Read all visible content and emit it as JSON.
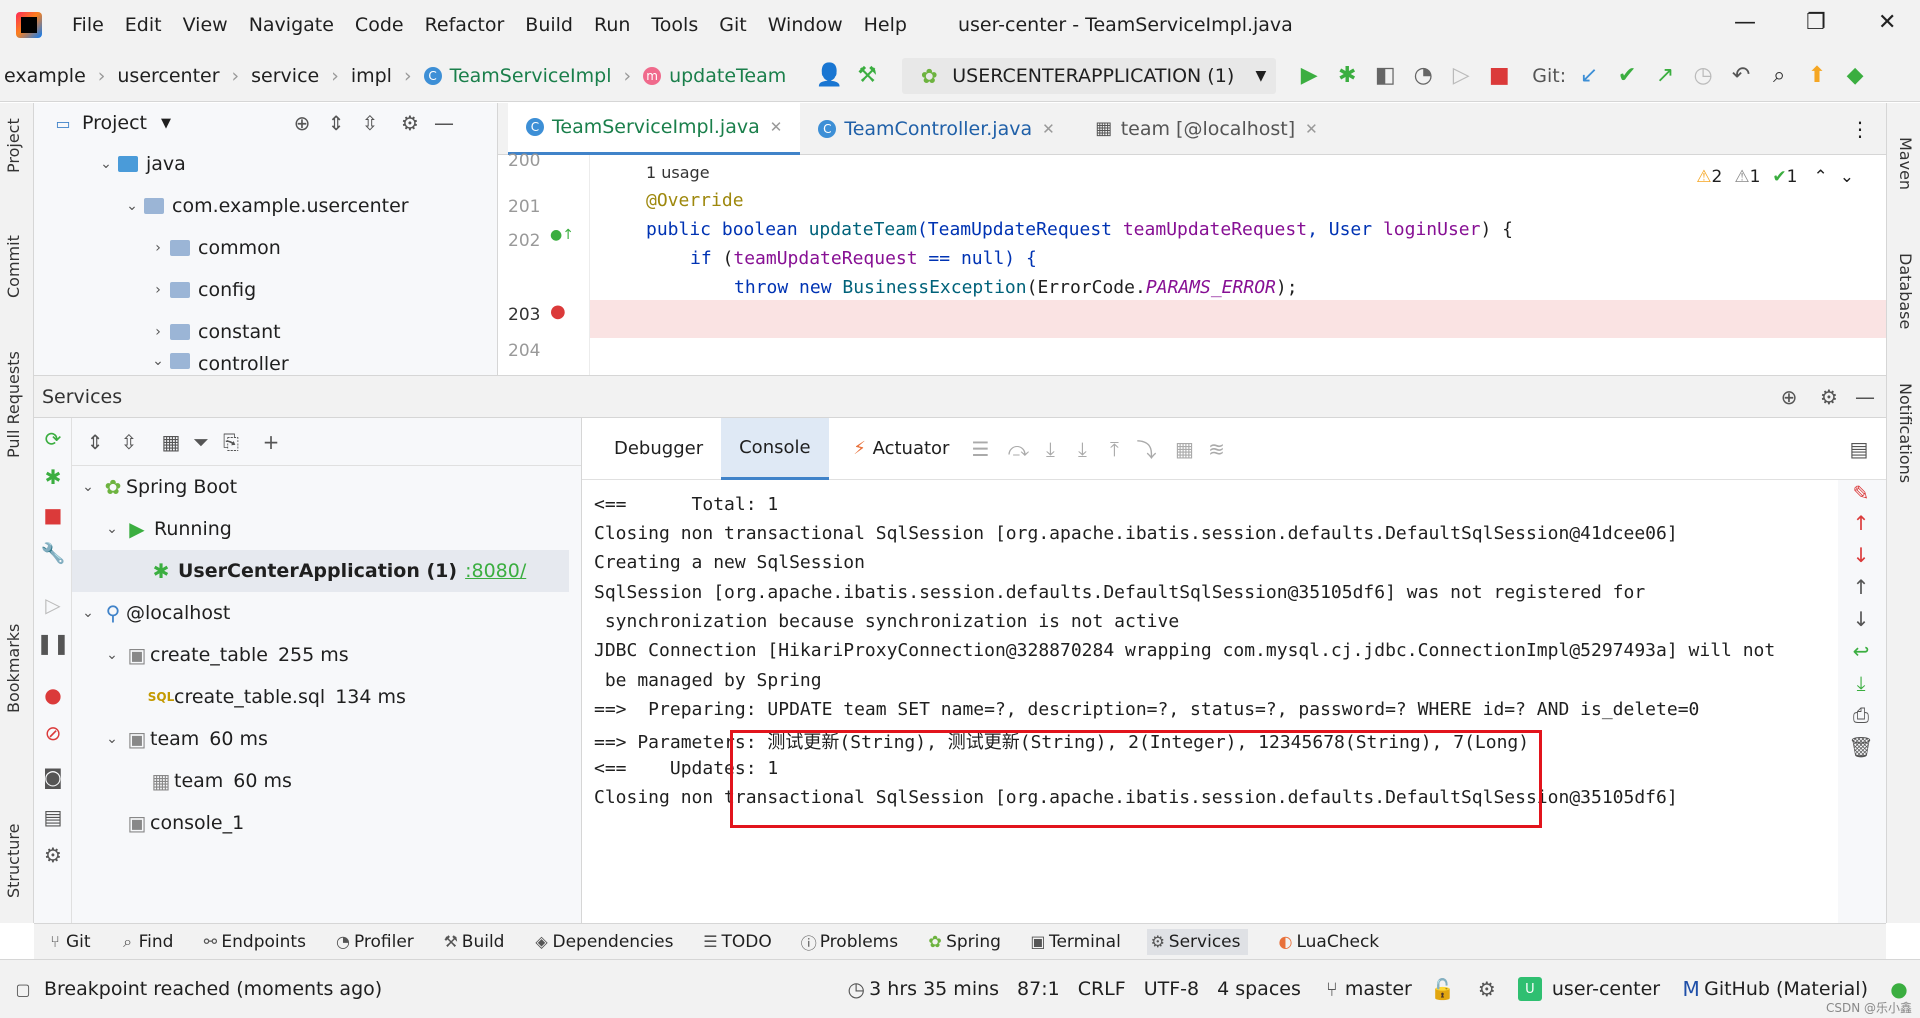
{
  "menubar": {
    "items": [
      "File",
      "Edit",
      "View",
      "Navigate",
      "Code",
      "Refactor",
      "Build",
      "Run",
      "Tools",
      "Git",
      "Window",
      "Help"
    ],
    "window_title": "user-center - TeamServiceImpl.java"
  },
  "navbar": {
    "crumbs": [
      "example",
      "usercenter",
      "service",
      "impl",
      "TeamServiceImpl",
      "updateTeam"
    ],
    "run_config": "USERCENTERAPPLICATION (1)",
    "git_label": "Git:"
  },
  "left_strip": [
    "Project",
    "Commit",
    "Pull Requests",
    "Bookmarks",
    "Structure"
  ],
  "right_strip": [
    "Maven",
    "Database",
    "Notifications"
  ],
  "project": {
    "title": "Project",
    "tree": [
      {
        "label": "java",
        "indent": 1
      },
      {
        "label": "com.example.usercenter",
        "indent": 2
      },
      {
        "label": "common",
        "indent": 3
      },
      {
        "label": "config",
        "indent": 3
      },
      {
        "label": "constant",
        "indent": 3
      },
      {
        "label": "controller",
        "indent": 3
      }
    ]
  },
  "editor": {
    "tabs": [
      "TeamServiceImpl.java",
      "TeamController.java",
      "team [@localhost]"
    ],
    "inspections": {
      "warn": "2",
      "weak": "1",
      "ok": "1"
    },
    "line_numbers": [
      "200",
      "201",
      "202",
      "203",
      "204"
    ],
    "usage": "1 usage",
    "code": {
      "l201": "@Override",
      "l202_kw": "public boolean ",
      "l202_fn": "updateTeam",
      "l202_rest": "(TeamUpdateRequest ",
      "l202_p1": "teamUpdateRequest",
      "l202_mid": ", User ",
      "l202_p2": "loginUser",
      "l202_end": ") {",
      "l203_kw": "if ",
      "l203_open": "(",
      "l203_p": "teamUpdateRequest",
      "l203_rest": " == null) {",
      "l204_kw": "throw new ",
      "l204_cls": "BusinessException",
      "l204_open": "(ErrorCode.",
      "l204_const": "PARAMS_ERROR",
      "l204_end": ");"
    }
  },
  "services": {
    "title": "Services",
    "tree": [
      {
        "label": "Spring Boot",
        "indent": 0
      },
      {
        "label": "Running",
        "indent": 1
      },
      {
        "label": "UserCenterApplication (1)",
        "extra": ":8080/",
        "indent": 2
      },
      {
        "label": "@localhost",
        "indent": 0
      },
      {
        "label": "create_table",
        "extra": "255 ms",
        "indent": 1
      },
      {
        "label": "create_table.sql",
        "extra": "134 ms",
        "indent": 2
      },
      {
        "label": "team",
        "extra": "60 ms",
        "indent": 1
      },
      {
        "label": "team",
        "extra": "60 ms",
        "indent": 2
      },
      {
        "label": "console_1",
        "indent": 1
      }
    ],
    "console_tabs": [
      "Debugger",
      "Console",
      "Actuator"
    ],
    "console_lines": [
      "<==      Total: 1",
      "Closing non transactional SqlSession [org.apache.ibatis.session.defaults.DefaultSqlSession@41dcee06]",
      "Creating a new SqlSession",
      "SqlSession [org.apache.ibatis.session.defaults.DefaultSqlSession@35105df6] was not registered for",
      " synchronization because synchronization is not active",
      "JDBC Connection [HikariProxyConnection@328870284 wrapping com.mysql.cj.jdbc.ConnectionImpl@5297493a] will not",
      " be managed by Spring",
      "==>  Preparing: UPDATE team SET name=?, description=?, status=?, password=? WHERE id=? AND is_delete=0",
      "==> Parameters: 测试更新(String), 测试更新(String), 2(Integer), 12345678(String), 7(Long)",
      "<==    Updates: 1",
      "Closing non transactional SqlSession [org.apache.ibatis.session.defaults.DefaultSqlSession@35105df6]"
    ]
  },
  "bottom_tabs": [
    "Git",
    "Find",
    "Endpoints",
    "Profiler",
    "Build",
    "Dependencies",
    "TODO",
    "Problems",
    "Spring",
    "Terminal",
    "Services",
    "LuaCheck"
  ],
  "status": {
    "message": "Breakpoint reached (moments ago)",
    "time": "3 hrs 35 mins",
    "position": "87:1",
    "line_sep": "CRLF",
    "encoding": "UTF-8",
    "indent": "4 spaces",
    "branch": "master",
    "project": "user-center",
    "theme": "GitHub (Material)",
    "avatar_letter": "U",
    "watermark": "CSDN @乐小鑫"
  },
  "colors": {
    "accent": "#4083c9",
    "highlight_box": "#e2141c",
    "run_green": "#3bae40",
    "stop_red": "#db3a3a"
  }
}
